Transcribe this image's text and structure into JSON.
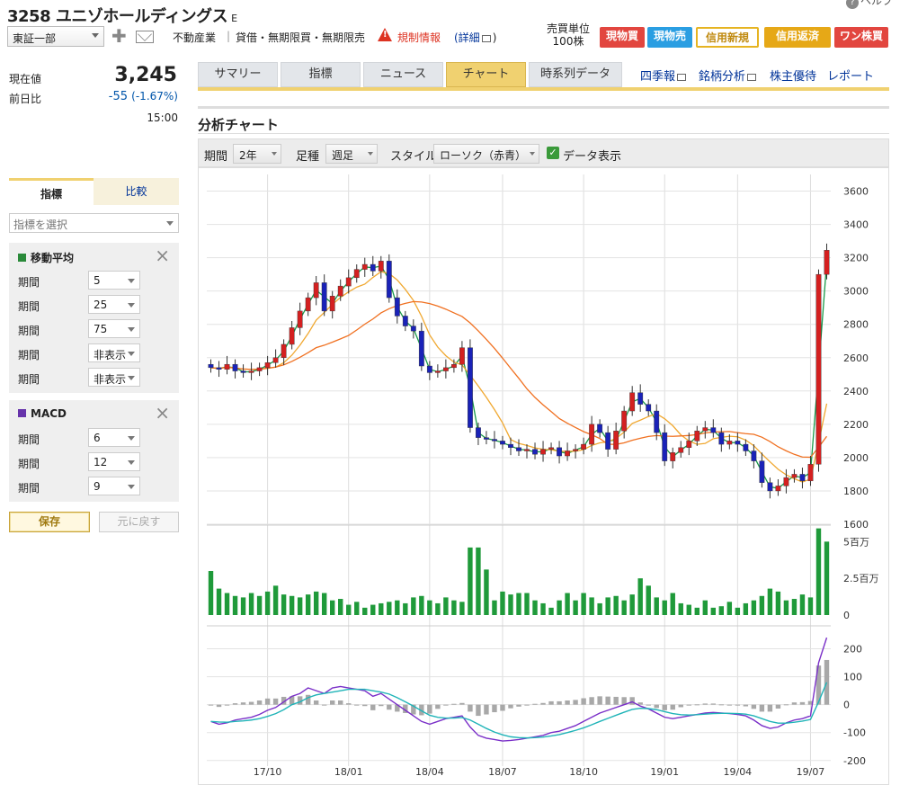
{
  "header": {
    "title": "3258 ユニゾホールディングス",
    "title_mark": "E",
    "help": "ヘルプ",
    "market": "東証一部",
    "industry": "不動産業",
    "lending": "貸借・無期限買・無期限売",
    "regulation": "規制情報",
    "detail": "(詳細",
    "detail_close": ")",
    "unit_label": "売買単位",
    "unit_value": "100株",
    "buttons": [
      "現物買",
      "現物売",
      "信用新規",
      "信用返済",
      "ワン株買"
    ],
    "button_colors": [
      "#e2463f",
      "#2a9ee2",
      "#f5c842",
      "#e6a817",
      "#e2463f"
    ]
  },
  "quote": {
    "current_label": "現在値",
    "current_value": "3,245",
    "change_label": "前日比",
    "change_value": "-55",
    "change_pct": "(-1.67%)",
    "time": "15:00"
  },
  "left_tabs": [
    "指標",
    "比較"
  ],
  "indicator_select": "指標を選択",
  "ma": {
    "title": "移動平均",
    "color": "#2a8a3a",
    "rows": [
      {
        "label": "期間",
        "value": "5"
      },
      {
        "label": "期間",
        "value": "25"
      },
      {
        "label": "期間",
        "value": "75"
      },
      {
        "label": "期間",
        "value": "非表示"
      },
      {
        "label": "期間",
        "value": "非表示"
      }
    ]
  },
  "macd": {
    "title": "MACD",
    "color": "#6633aa",
    "rows": [
      {
        "label": "期間",
        "value": "6"
      },
      {
        "label": "期間",
        "value": "12"
      },
      {
        "label": "期間",
        "value": "9"
      }
    ]
  },
  "save_label": "保存",
  "undo_label": "元に戻す",
  "tabs": [
    "サマリー",
    "指標",
    "ニュース",
    "チャート",
    "時系列データ"
  ],
  "active_tab": "チャート",
  "right_links": [
    "四季報",
    "銘柄分析",
    "株主優待",
    "レポート"
  ],
  "section_title": "分析チャート",
  "controls": {
    "period_label": "期間",
    "period_value": "2年",
    "foot_label": "足種",
    "foot_value": "週足",
    "style_label": "スタイル",
    "style_value": "ローソク（赤青）",
    "data_label": "データ表示"
  },
  "chart_data": {
    "type": "candlestick",
    "x_ticks": [
      "17/10",
      "18/01",
      "18/04",
      "18/07",
      "18/10",
      "19/01",
      "19/04",
      "19/07"
    ],
    "price_ticks": [
      3600,
      3400,
      3200,
      3000,
      2800,
      2600,
      2400,
      2200,
      2000,
      1800,
      1600
    ],
    "ylim": [
      1600,
      3700
    ],
    "volume_ticks": [
      "5百万",
      "2.5百万",
      "0"
    ],
    "volume_max": 6,
    "macd_ticks": [
      200,
      100,
      0,
      -100,
      -200
    ],
    "macd_ylim": [
      -220,
      250
    ],
    "up_color": "#d42020",
    "down_color": "#1a22b8",
    "ma_colors": [
      "#1a9a4a",
      "#f0a830",
      "#f07020"
    ],
    "macd_colors": [
      "#7a2fc8",
      "#20b4b8"
    ],
    "closes": [
      2540,
      2530,
      2560,
      2520,
      2510,
      2520,
      2540,
      2570,
      2600,
      2680,
      2780,
      2880,
      2960,
      3050,
      2880,
      2970,
      3030,
      3080,
      3130,
      3160,
      3120,
      3180,
      2960,
      2850,
      2790,
      2760,
      2550,
      2510,
      2520,
      2540,
      2560,
      2660,
      2180,
      2120,
      2110,
      2100,
      2080,
      2060,
      2040,
      2050,
      2020,
      2050,
      2060,
      2010,
      2040,
      2050,
      2080,
      2200,
      2150,
      2050,
      2160,
      2280,
      2390,
      2320,
      2280,
      2150,
      1980,
      2030,
      2060,
      2100,
      2160,
      2180,
      2150,
      2080,
      2100,
      2080,
      2040,
      1980,
      1850,
      1800,
      1830,
      1880,
      1900,
      1860,
      1960,
      3100,
      3245
    ],
    "volumes": [
      3.0,
      1.8,
      1.5,
      1.3,
      1.2,
      1.5,
      1.3,
      1.6,
      2.0,
      1.4,
      1.3,
      1.2,
      1.4,
      1.6,
      1.5,
      1.0,
      1.1,
      0.7,
      0.9,
      0.5,
      0.7,
      0.8,
      0.9,
      1.0,
      0.8,
      1.2,
      1.3,
      1.0,
      0.8,
      1.2,
      1.0,
      0.9,
      4.6,
      4.6,
      3.1,
      1.0,
      1.6,
      1.4,
      1.5,
      1.5,
      1.0,
      0.8,
      0.5,
      1.0,
      1.5,
      1.0,
      1.5,
      1.2,
      0.8,
      1.2,
      1.3,
      1.0,
      1.4,
      2.5,
      2.0,
      1.2,
      1.0,
      1.5,
      0.8,
      0.7,
      0.5,
      1.0,
      0.5,
      0.6,
      0.9,
      0.5,
      0.8,
      1.0,
      1.3,
      1.8,
      1.6,
      1.0,
      1.1,
      1.4,
      1.2,
      5.9,
      5.0
    ],
    "macd": [
      -60,
      -70,
      -65,
      -55,
      -50,
      -45,
      -35,
      -20,
      -10,
      10,
      30,
      40,
      60,
      50,
      40,
      60,
      65,
      60,
      55,
      50,
      30,
      40,
      20,
      0,
      -20,
      -40,
      -60,
      -70,
      -60,
      -50,
      -45,
      -40,
      -80,
      -110,
      -120,
      -125,
      -130,
      -128,
      -125,
      -120,
      -115,
      -110,
      -100,
      -95,
      -85,
      -75,
      -60,
      -45,
      -30,
      -20,
      -10,
      0,
      10,
      -5,
      -15,
      -30,
      -45,
      -50,
      -45,
      -40,
      -35,
      -30,
      -28,
      -30,
      -32,
      -35,
      -40,
      -55,
      -75,
      -85,
      -80,
      -65,
      -55,
      -50,
      -40,
      150,
      240
    ],
    "signal": [
      -60,
      -62,
      -63,
      -60,
      -58,
      -55,
      -50,
      -42,
      -32,
      -18,
      0,
      10,
      25,
      35,
      40,
      45,
      50,
      55,
      55,
      55,
      50,
      45,
      38,
      25,
      10,
      -5,
      -22,
      -38,
      -45,
      -48,
      -48,
      -46,
      -55,
      -70,
      -85,
      -98,
      -108,
      -115,
      -118,
      -119,
      -118,
      -116,
      -112,
      -107,
      -100,
      -92,
      -83,
      -72,
      -60,
      -49,
      -38,
      -27,
      -17,
      -13,
      -14,
      -18,
      -25,
      -32,
      -36,
      -37,
      -36,
      -34,
      -32,
      -31,
      -31,
      -32,
      -34,
      -40,
      -50,
      -60,
      -66,
      -66,
      -63,
      -59,
      -53,
      10,
      80
    ]
  }
}
